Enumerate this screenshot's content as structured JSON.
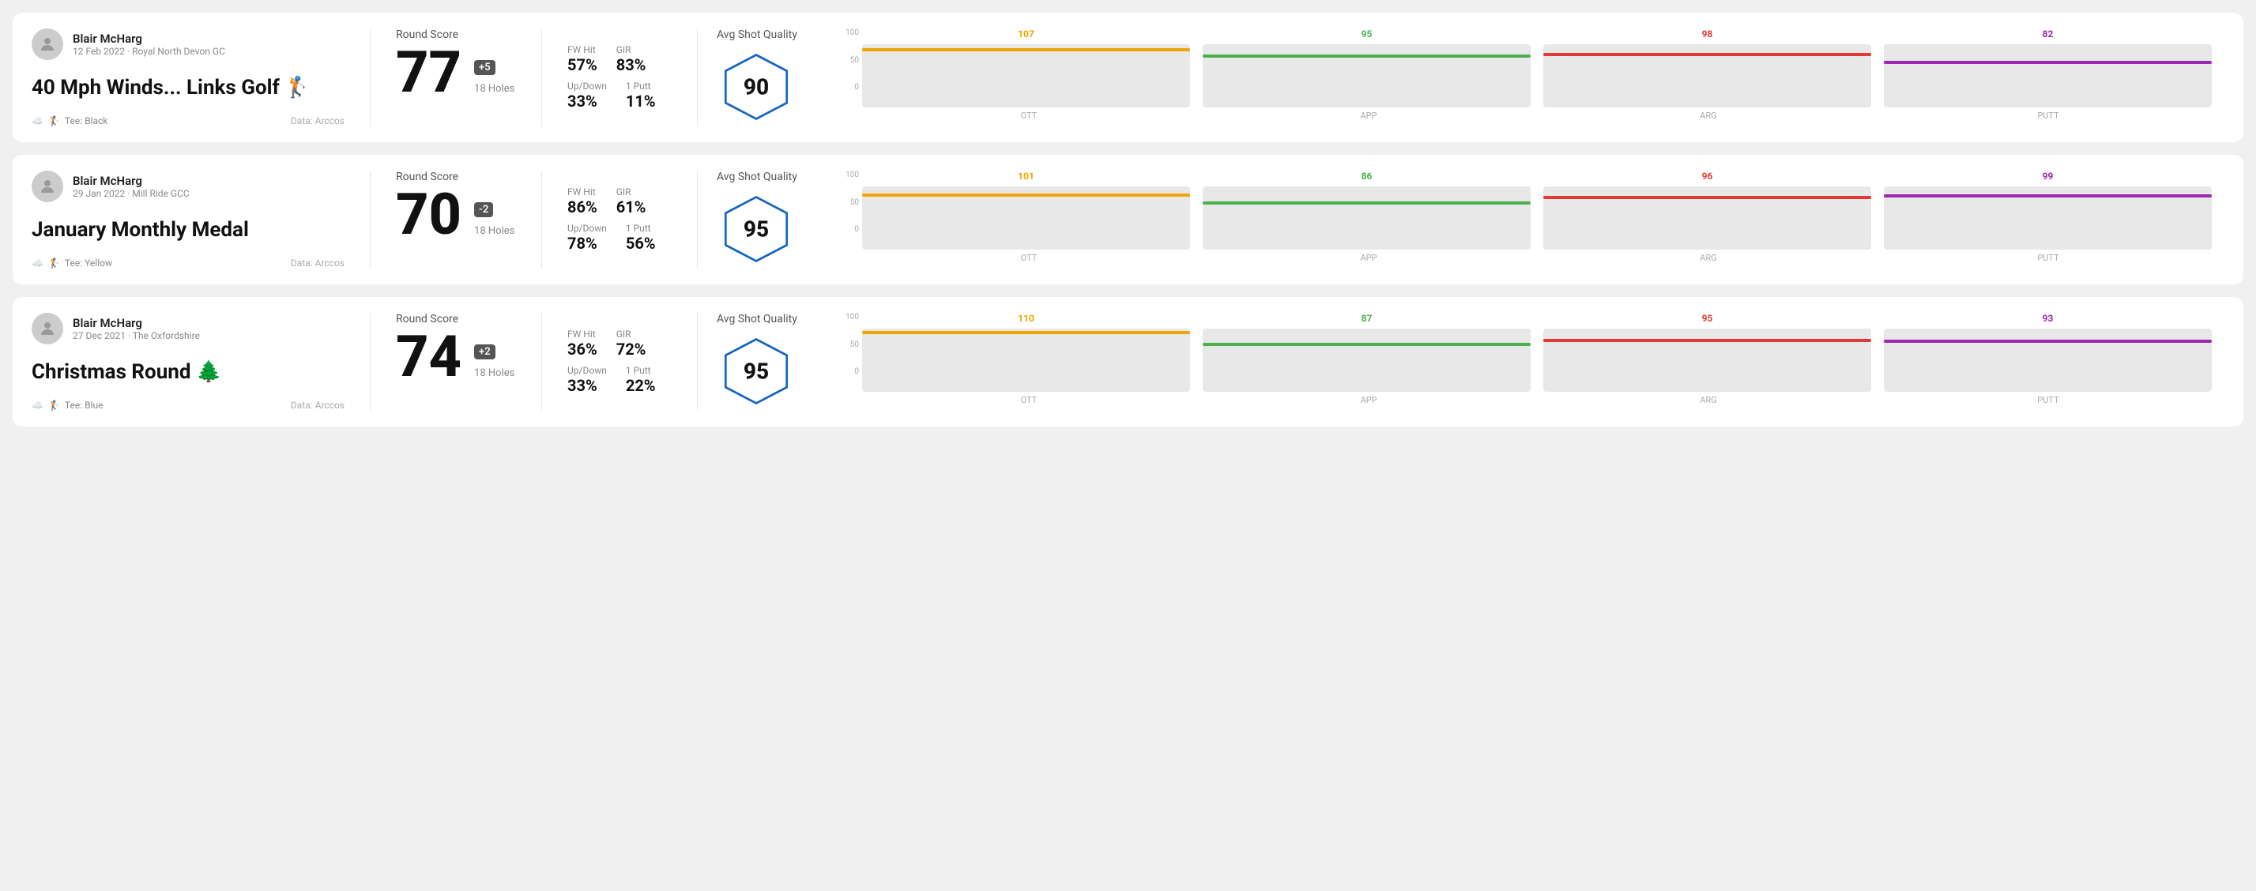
{
  "rounds": [
    {
      "id": "round1",
      "user": {
        "name": "Blair McHarg",
        "meta": "12 Feb 2022 · Royal North Devon GC"
      },
      "title": "40 Mph Winds... Links Golf 🏌️",
      "tee": "Black",
      "data_source": "Data: Arccos",
      "score": "77",
      "score_diff": "+5",
      "holes": "18 Holes",
      "fw_hit": "57%",
      "gir": "83%",
      "up_down": "33%",
      "one_putt": "11%",
      "avg_quality": "90",
      "chart": {
        "ott": {
          "value": 107,
          "color": "#f0a500"
        },
        "app": {
          "value": 95,
          "color": "#4caf50"
        },
        "arg": {
          "value": 98,
          "color": "#e53935"
        },
        "putt": {
          "value": 82,
          "color": "#9c27b0"
        }
      }
    },
    {
      "id": "round2",
      "user": {
        "name": "Blair McHarg",
        "meta": "29 Jan 2022 · Mill Ride GCC"
      },
      "title": "January Monthly Medal",
      "tee": "Yellow",
      "data_source": "Data: Arccos",
      "score": "70",
      "score_diff": "-2",
      "holes": "18 Holes",
      "fw_hit": "86%",
      "gir": "61%",
      "up_down": "78%",
      "one_putt": "56%",
      "avg_quality": "95",
      "chart": {
        "ott": {
          "value": 101,
          "color": "#f0a500"
        },
        "app": {
          "value": 86,
          "color": "#4caf50"
        },
        "arg": {
          "value": 96,
          "color": "#e53935"
        },
        "putt": {
          "value": 99,
          "color": "#9c27b0"
        }
      }
    },
    {
      "id": "round3",
      "user": {
        "name": "Blair McHarg",
        "meta": "27 Dec 2021 · The Oxfordshire"
      },
      "title": "Christmas Round 🌲",
      "tee": "Blue",
      "data_source": "Data: Arccos",
      "score": "74",
      "score_diff": "+2",
      "holes": "18 Holes",
      "fw_hit": "36%",
      "gir": "72%",
      "up_down": "33%",
      "one_putt": "22%",
      "avg_quality": "95",
      "chart": {
        "ott": {
          "value": 110,
          "color": "#f0a500"
        },
        "app": {
          "value": 87,
          "color": "#4caf50"
        },
        "arg": {
          "value": 95,
          "color": "#e53935"
        },
        "putt": {
          "value": 93,
          "color": "#9c27b0"
        }
      }
    }
  ],
  "labels": {
    "round_score": "Round Score",
    "fw_hit": "FW Hit",
    "gir": "GIR",
    "up_down": "Up/Down",
    "one_putt": "1 Putt",
    "avg_quality": "Avg Shot Quality",
    "ott": "OTT",
    "app": "APP",
    "arg": "ARG",
    "putt": "PUTT",
    "tee_prefix": "Tee:",
    "y100": "100",
    "y50": "50",
    "y0": "0"
  }
}
